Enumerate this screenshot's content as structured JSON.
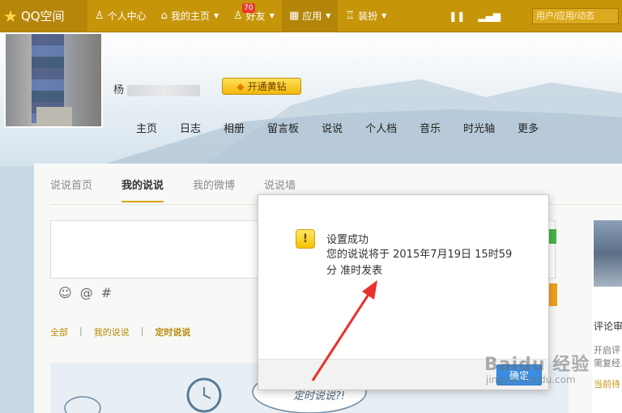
{
  "topbar": {
    "brand": "QQ空间",
    "nav": [
      {
        "label": "个人中心",
        "icon": "person-icon"
      },
      {
        "label": "我的主页",
        "icon": "home-icon"
      },
      {
        "label": "好友",
        "icon": "friends-icon",
        "badge": "70"
      },
      {
        "label": "应用",
        "icon": "apps-grid-icon"
      },
      {
        "label": "装扮",
        "icon": "shirt-icon"
      }
    ],
    "search_placeholder": "用户/应用/动态"
  },
  "header": {
    "username_visible": "杨",
    "gold_button": "开通黄钻",
    "nav": [
      "主页",
      "日志",
      "相册",
      "留言板",
      "说说",
      "个人档",
      "音乐",
      "时光轴",
      "更多"
    ]
  },
  "tabs": [
    "说说首页",
    "我的说说",
    "我的微博",
    "说说墙"
  ],
  "active_tab": "我的说说",
  "filters": {
    "all": "全部",
    "mine": "我的说说",
    "scheduled": "定时说说"
  },
  "illustration_text": "定时说说?!",
  "right_panel": {
    "line1": "评论审",
    "line2": "开启评",
    "line3": "需复经",
    "line4": "当前待"
  },
  "modal": {
    "title": "设置成功",
    "message": "您的说说将于 2015年7月19日 15时59分 准时发表",
    "confirm_label": "确定"
  },
  "watermark": {
    "main": "Baidu 经验",
    "sub": "jingyan.baidu.com"
  },
  "colors": {
    "topbar": "#c7950a",
    "accent": "#d8a316",
    "arrow": "#e8322b",
    "confirm": "#3a8de0"
  }
}
